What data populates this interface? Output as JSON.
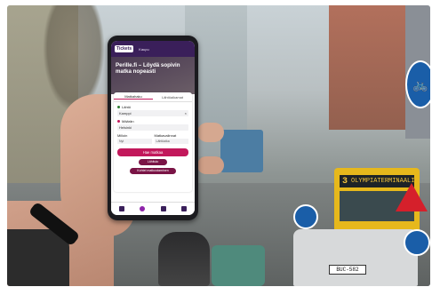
{
  "app": {
    "logo": "Tickets",
    "top_tab": "Kaupu",
    "headline": "Perille.fi – Löydä sopivin matka nopeasti",
    "tabs": [
      "Matkahaku",
      "Lähtöaikamat"
    ],
    "from_label": "Lähtö",
    "from_value": "Kamppi",
    "to_label": "Määrän",
    "to_value": "Helsinki",
    "when_label": "Milloin",
    "when_value": "Nyt",
    "options_label": "Matkavalinnat",
    "options_value": "Lähtöaika",
    "search_button": "Hae matkaa",
    "pill_1": "Lähitulo",
    "pill_2": "Kohtei matkustaminen"
  },
  "scene": {
    "tram_number": "3",
    "tram_destination": "OLYMPIATERMINAALI",
    "plate": "BUC-582"
  },
  "colors": {
    "brand": "#3a1f5a",
    "accent": "#c2185b"
  }
}
